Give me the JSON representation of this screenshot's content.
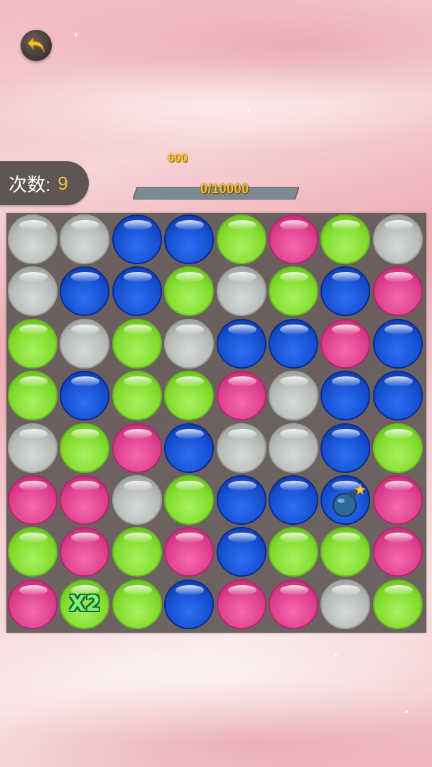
{
  "hud": {
    "moves_label": "次数:",
    "moves_value": "9",
    "target_score": "600",
    "progress_text": "0/10000",
    "progress_fraction": 0
  },
  "icons": {
    "back": "back-arrow-icon",
    "bomb": "bomb-icon"
  },
  "colors": {
    "gray": "#b9bdb9",
    "blue": "#1650d3",
    "green": "#84dd2e",
    "pink": "#e0408e",
    "score_gold": "#f5c22e"
  },
  "board": {
    "rows": [
      [
        "gray",
        "gray",
        "blue",
        "blue",
        "green",
        "pink",
        "green",
        "gray"
      ],
      [
        "gray",
        "blue",
        "blue",
        "green",
        "gray",
        "green",
        "blue",
        "pink"
      ],
      [
        "green",
        "gray",
        "green",
        "gray",
        "blue",
        "blue",
        "pink",
        "blue"
      ],
      [
        "green",
        "blue",
        "green",
        "green",
        "pink",
        "gray",
        "blue",
        "blue"
      ],
      [
        "gray",
        "green",
        "pink",
        "blue",
        "gray",
        "gray",
        "blue",
        "green"
      ],
      [
        "pink",
        "pink",
        "gray",
        "green",
        "blue",
        "blue",
        "blue",
        "pink"
      ],
      [
        "green",
        "pink",
        "green",
        "pink",
        "blue",
        "green",
        "green",
        "pink"
      ],
      [
        "pink",
        "green",
        "green",
        "blue",
        "pink",
        "pink",
        "gray",
        "green"
      ]
    ],
    "specials": [
      {
        "row": 5,
        "col": 6,
        "type": "bomb"
      },
      {
        "row": 7,
        "col": 1,
        "type": "multiplier",
        "label": "X2"
      }
    ]
  }
}
